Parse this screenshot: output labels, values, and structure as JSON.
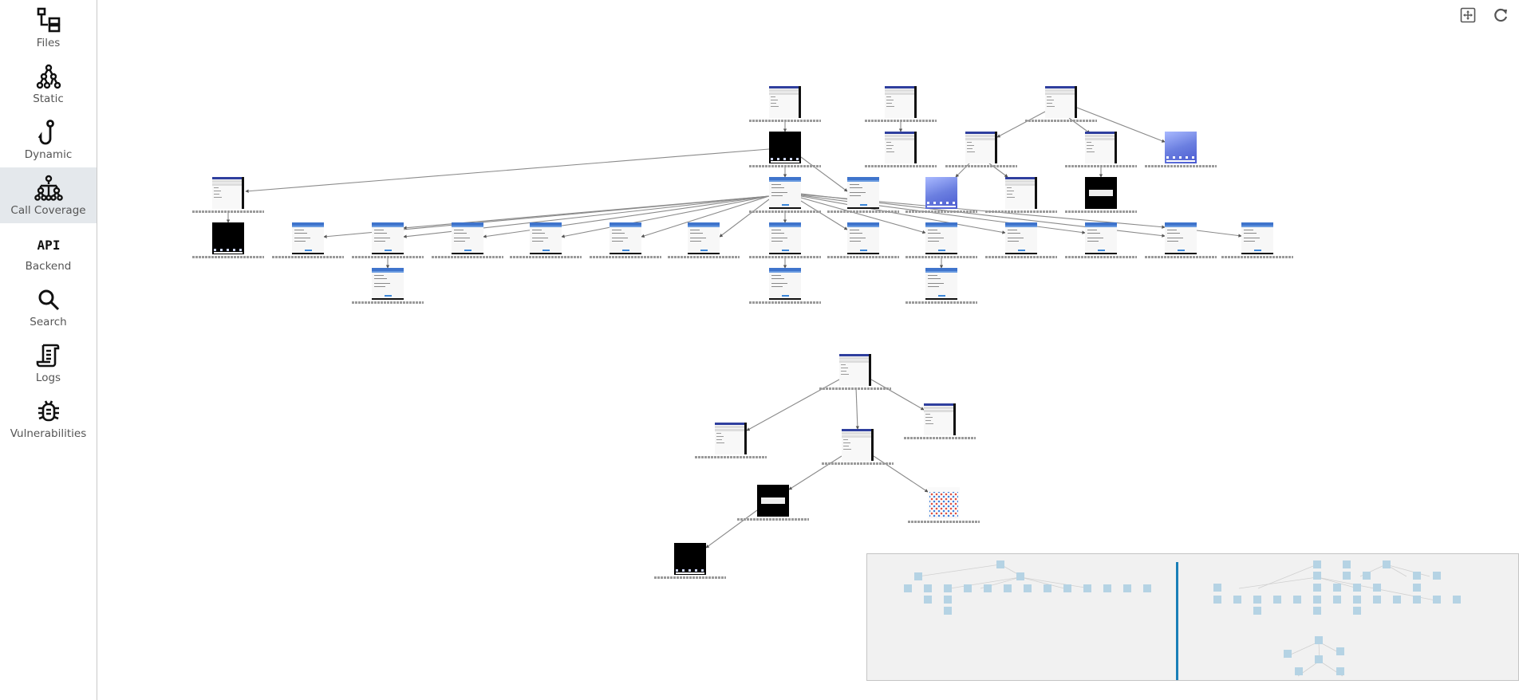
{
  "sidebar": {
    "items": [
      {
        "label": "Files",
        "icon": "files-icon",
        "active": false
      },
      {
        "label": "Static",
        "icon": "static-graph-icon",
        "active": false
      },
      {
        "label": "Dynamic",
        "icon": "hook-icon",
        "active": false
      },
      {
        "label": "Call Coverage",
        "icon": "call-tree-icon",
        "active": true
      },
      {
        "label": "Backend",
        "icon": "api-icon",
        "active": false
      },
      {
        "label": "Search",
        "icon": "search-icon",
        "active": false
      },
      {
        "label": "Logs",
        "icon": "scroll-icon",
        "active": false
      },
      {
        "label": "Vulnerabilities",
        "icon": "bug-icon",
        "active": false
      }
    ]
  },
  "toolbar": {
    "fit_view_icon": "fit-view-icon",
    "refresh_icon": "refresh-icon"
  },
  "graph": {
    "node_screen_types": [
      "form",
      "legacy",
      "black-home",
      "black-dialog",
      "wallpaper",
      "app-grid"
    ],
    "caption_note": "node captions are unreadably small activity names"
  },
  "colors": {
    "active_nav_bg": "#e4e8ec",
    "minimap_node": "#b5d3e4",
    "minimap_viewport": "#1a7fb8",
    "edge": "#8a8a8a"
  }
}
